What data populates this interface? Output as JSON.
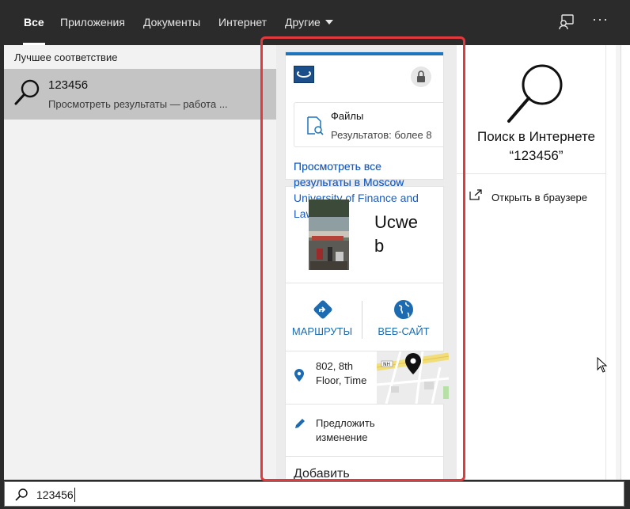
{
  "tabs": [
    {
      "label": "Все",
      "active": true
    },
    {
      "label": "Приложения"
    },
    {
      "label": "Документы"
    },
    {
      "label": "Интернет"
    },
    {
      "label": "Другие"
    }
  ],
  "top_icons": [
    "feedback-icon",
    "more-icon"
  ],
  "more_glyph": "···",
  "left": {
    "section_title": "Лучшее соответствие",
    "best_match": {
      "title": "123456",
      "subtitle": "Просмотреть результаты — работа ..."
    }
  },
  "card": {
    "files_title": "Файлы",
    "files_subtitle": "Результатов: более 8",
    "view_all_link": "Просмотреть все результаты в Moscow University of Finance and Law",
    "entity_name": "Ucwe b",
    "actions": [
      {
        "label": "МАРШРУТЫ",
        "icon": "directions-icon"
      },
      {
        "label": "ВЕБ-САЙТ",
        "icon": "globe-icon"
      }
    ],
    "address": "802, 8th Floor, Time",
    "suggest_edit": "Предложить изменение",
    "add_label": "Добавить"
  },
  "right": {
    "web_search_title": "Поиск в Интернете",
    "web_search_query": "“123456”",
    "open_browser": "Открыть в браузере"
  },
  "search": {
    "value": "123456"
  },
  "colors": {
    "accent_blue": "#1e73be",
    "link_blue": "#1c5cc0",
    "action_teal": "#1c6bb0",
    "annotation_red": "#e0393e",
    "dark_bar": "#2b2b2b"
  }
}
